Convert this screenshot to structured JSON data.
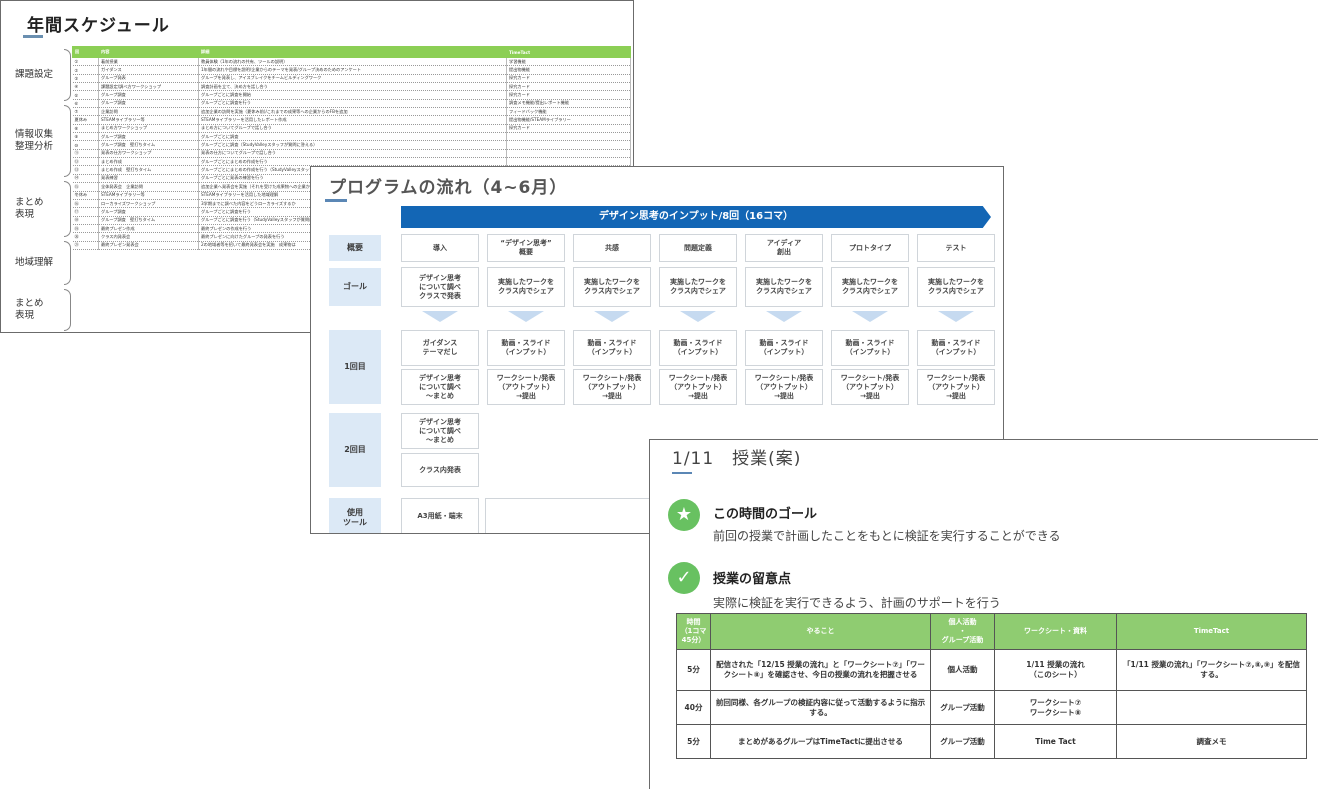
{
  "slide1": {
    "title": "年間スケジュール",
    "groups": [
      "課題設定",
      "情報収集\n整理分析",
      "まとめ\n表現",
      "地域理解",
      "まとめ\n表現"
    ],
    "headers": [
      "回",
      "内容",
      "詳細",
      "TimeTact"
    ],
    "rows": [
      [
        "①",
        "着前授業",
        "教員体験（1年の流れの共有、ツールの説明）",
        "学習機能"
      ],
      [
        "②",
        "ガイダンス",
        "1年間の流れや目標を説明/企業からのテーマを発表/グループ決めのためのアンケート",
        "提出物機能"
      ],
      [
        "③",
        "グループ発表",
        "グループを発表し、アイスブレイクをチームビルディングワーク",
        "探究カード"
      ],
      [
        "④",
        "課題設定/調べ方ワークショップ",
        "調査計画を立て、決め方を話し合う",
        "探究カード"
      ],
      [
        "⑤",
        "グループ調査",
        "グループごとに調査を開始",
        "探究カード"
      ],
      [
        "⑥",
        "グループ調査",
        "グループごとに調査を行う",
        "調査メモ機能/提出レポート機能"
      ],
      [
        "⑦",
        "企業訪問",
        "追加企業の訪問を実施（夏休み前)/これまでの成果等への企業からのFBを追加",
        "フィードバック機能"
      ],
      [
        "夏休み",
        "STEAMライブラリー等",
        "STEAMライブラリーを活用したレポート作成",
        "提出物機能/STEAMライブラリー"
      ],
      [
        "⑧",
        "まとめ方ワークショップ",
        "まとめ方についてグループで話し合う",
        "探究カード"
      ],
      [
        "⑨",
        "グループ調査",
        "グループごとに調査",
        ""
      ],
      [
        "⑩",
        "グループ調査　壁打ちタイム",
        "グループごとに調査（StudyValleyスタッフが質問に答える）",
        ""
      ],
      [
        "⑪",
        "発表の仕方ワークショップ",
        "発表の仕方についてグループで話し合う",
        ""
      ],
      [
        "⑫",
        "まとめ作成",
        "グループごとにまとめの作成を行う",
        ""
      ],
      [
        "⑬",
        "まとめ作成　壁打ちタイム",
        "グループごとにまとめの作成を行う（StudyValleyスタッフ）",
        ""
      ],
      [
        "⑭",
        "発表練習",
        "グループごとに発表の練習を行う",
        ""
      ],
      [
        "⑮",
        "全体発表会　企業訪問",
        "追加企業へ発表会を実施（それを受けた成果物への企業からのFB）",
        ""
      ],
      [
        "冬休み",
        "STEAMライブラリー等",
        "STEAMライブラリーを活用した地域理解",
        ""
      ],
      [
        "⑯",
        "ローカライズワークショップ",
        "3学期までに調べた内容をどうローカライズするか",
        ""
      ],
      [
        "⑰",
        "グループ調査",
        "グループごとに調査を行う",
        ""
      ],
      [
        "⑱",
        "グループ調査　壁打ちタイム",
        "グループごとに調査を行う（StudyValleyスタッフが質問に答える）",
        ""
      ],
      [
        "⑲",
        "最終プレゼン作成",
        "最終プレゼンの作成を行う",
        ""
      ],
      [
        "⑳",
        "クラス内発表会",
        "最終プレゼンに向けたグループの発表を行う",
        ""
      ],
      [
        "㉑",
        "最終プレゼン発表会",
        "2の地域者等を招いて最終発表会を実施　成果物は",
        ""
      ]
    ]
  },
  "slide2": {
    "title": "プログラムの流れ（4~6月）",
    "banner": "デザイン思考のインプット/8回（16コマ）",
    "row_labels": [
      "概要",
      "ゴール",
      "1回目",
      "2回目",
      "使用\nツール"
    ],
    "overview": [
      "導入",
      "“デザイン思考”\n概要",
      "共感",
      "問題定義",
      "アイディア\n創出",
      "プロトタイプ",
      "テスト"
    ],
    "goal_first": "デザイン思考\nについて調べ\nクラスで発表",
    "goal_rest": "実施したワークを\nクラス内でシェア",
    "r1_first_a": "ガイダンス\nテーマだし",
    "r1_first_b": "デザイン思考\nについて調べ\n～まとめ",
    "r1_a": "動画・スライド\n（インプット）",
    "r1_b": "ワークシート/発表\n（アウトプット）\n→提出",
    "r2_a": "デザイン思考\nについて調べ\n～まとめ",
    "r2_b": "クラス内発表",
    "tools": "A3用紙・端末"
  },
  "slide3": {
    "title": "1/11　授業(案)",
    "goal_heading": "この時間のゴール",
    "goal_text": "前回の授業で計画したことをもとに検証を実行することができる",
    "point_heading": "授業の留意点",
    "point_text": "実際に検証を実行できるよう、計画のサポートを行う",
    "star_icon": "★",
    "check_icon": "✓",
    "headers": [
      "時間\n（1コマ\n45分）",
      "やること",
      "個人活動\n・\nグループ活動",
      "ワークシート・資料",
      "TimeTact"
    ],
    "rows": [
      [
        "5分",
        "配信された「12/15 授業の流れ」と「ワークシート⑦」「ワークシート⑧」を確認させ、今日の授業の流れを把握させる",
        "個人活動",
        "1/11 授業の流れ\n（このシート）",
        "「1/11 授業の流れ」「ワークシート⑦,⑧,⑨」を配信する。"
      ],
      [
        "40分",
        "前回同様、各グループの検証内容に従って活動するように指示する。",
        "グループ活動",
        "ワークシート⑦\nワークシート⑧",
        ""
      ],
      [
        "5分",
        "まとめがあるグループはTimeTactに提出させる",
        "グループ活動",
        "Time Tact",
        "調査メモ"
      ]
    ]
  }
}
